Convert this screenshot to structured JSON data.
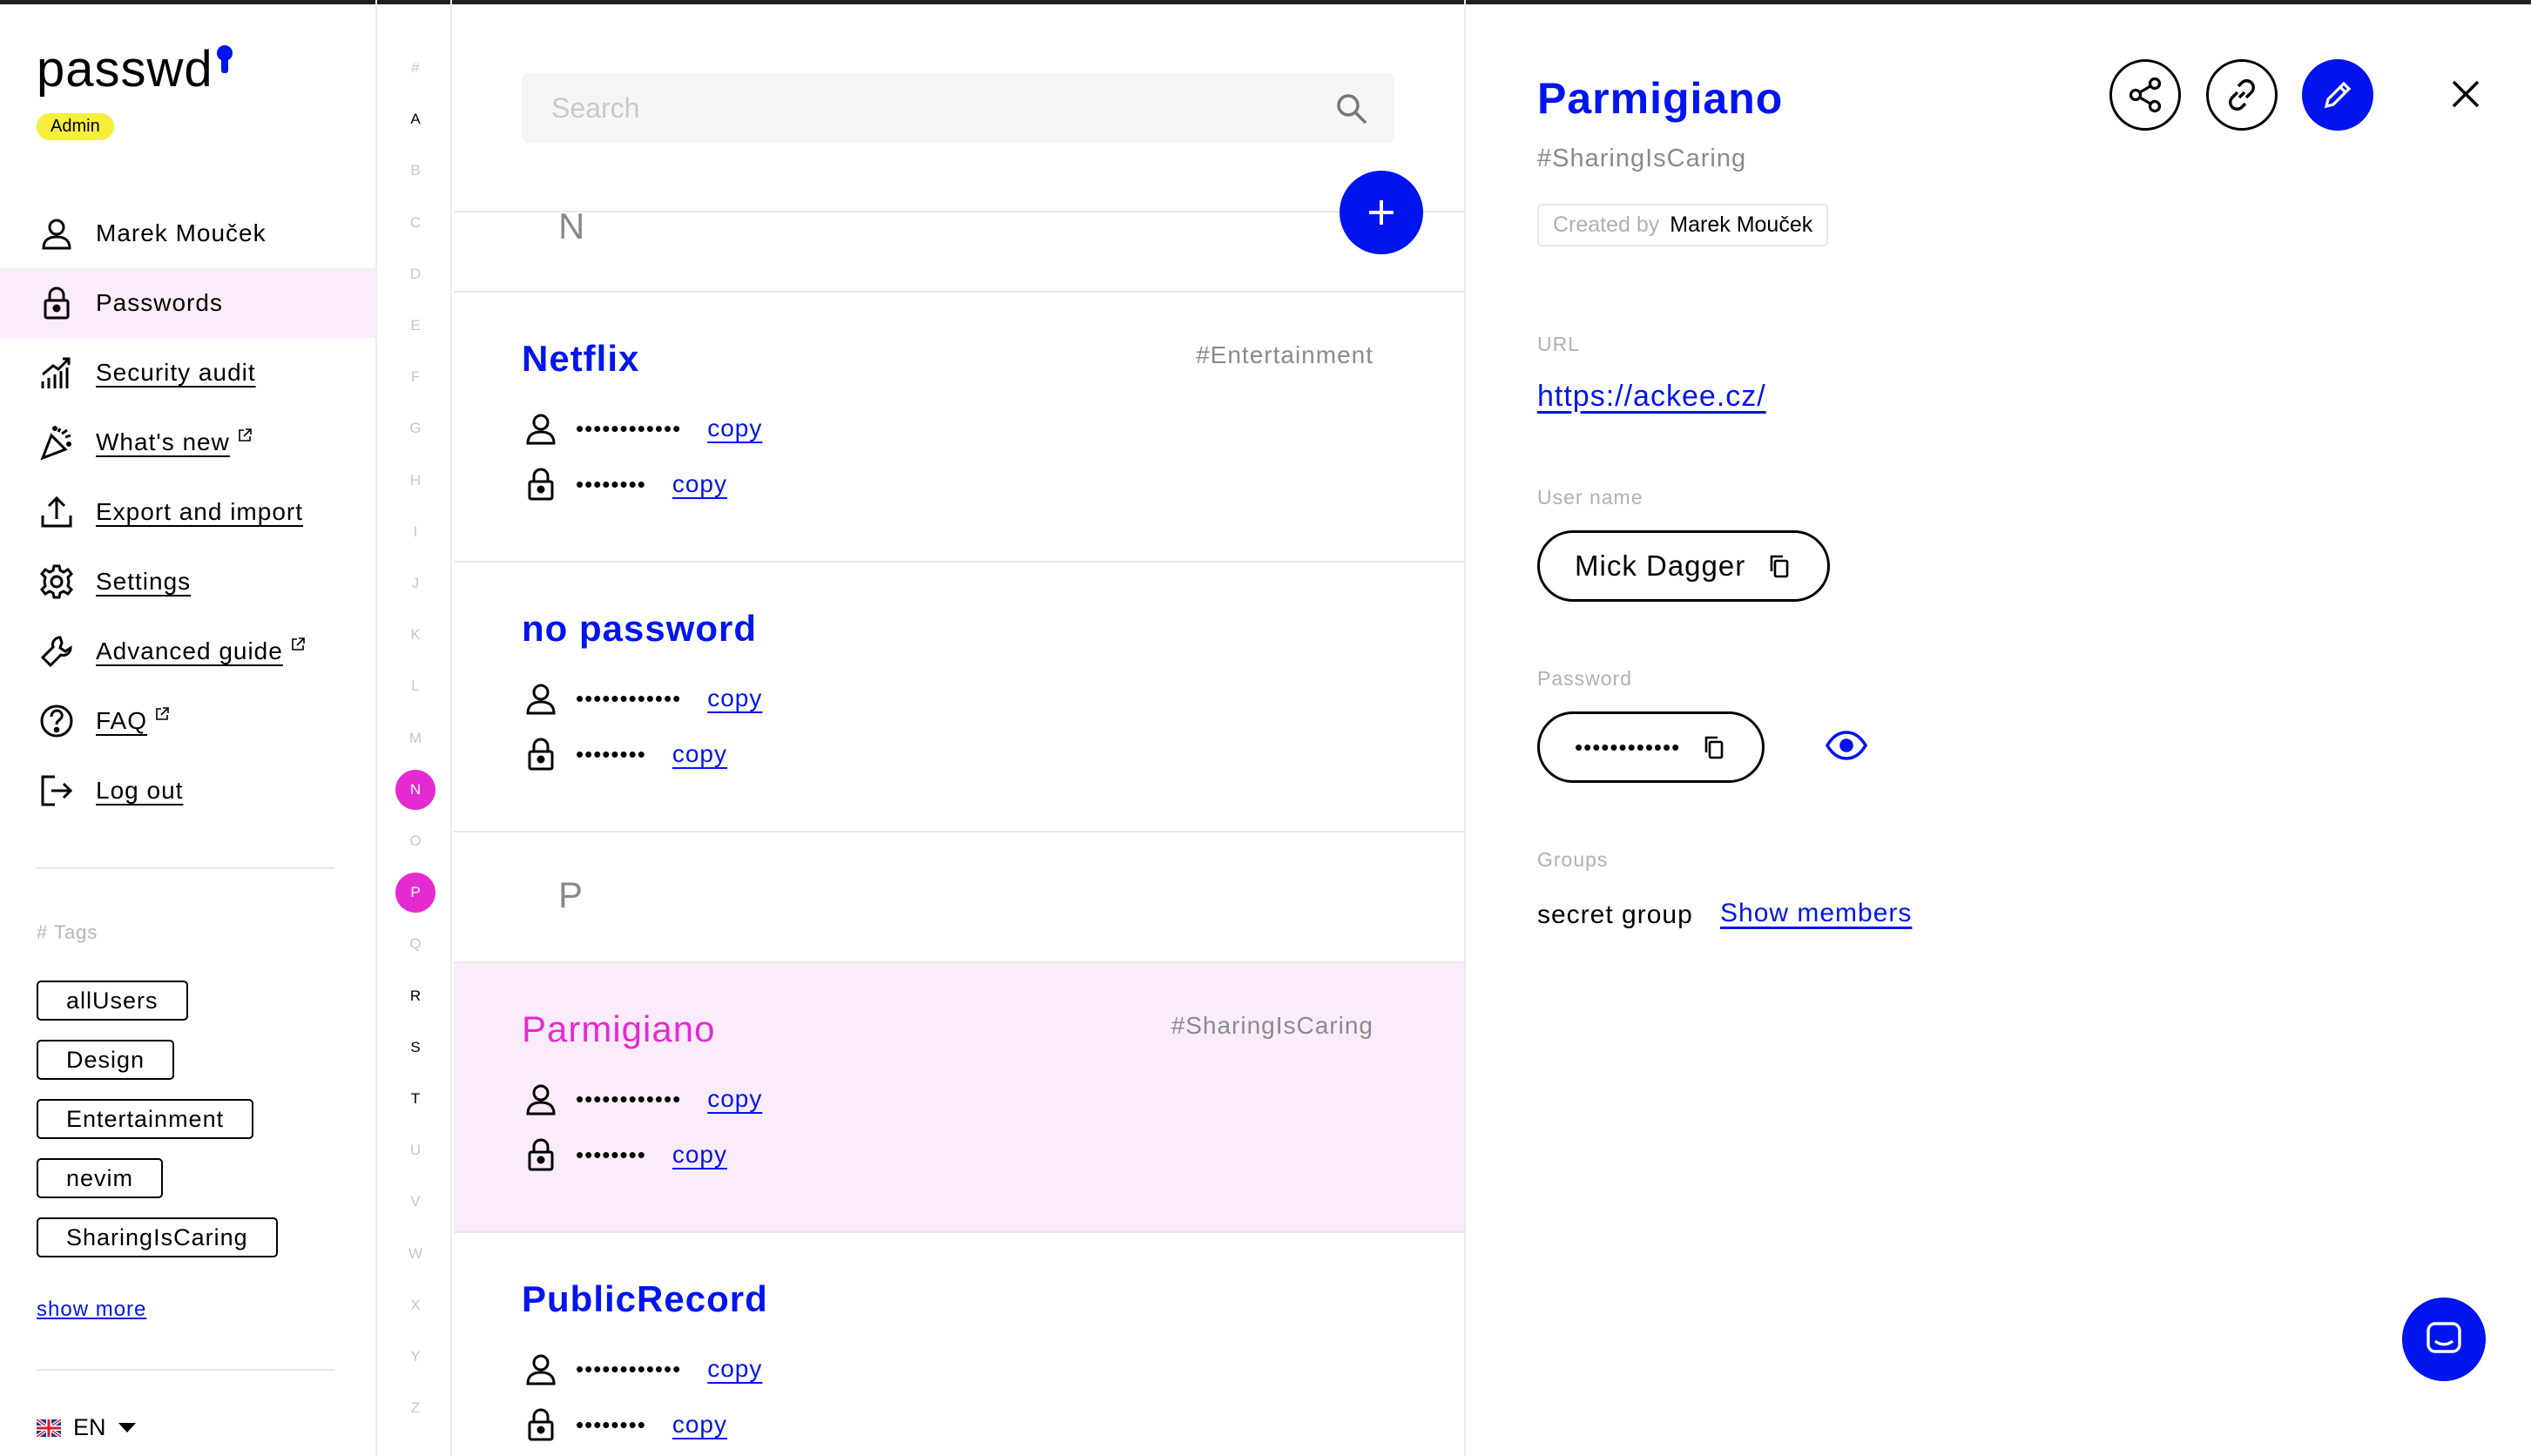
{
  "app": {
    "logo": "passwd",
    "role_badge": "Admin"
  },
  "sidebar": {
    "items": [
      {
        "label": "Marek Mouček",
        "icon": "user-icon",
        "active": false,
        "underlined": false
      },
      {
        "label": "Passwords",
        "icon": "lock-icon",
        "active": true,
        "underlined": false
      },
      {
        "label": "Security audit",
        "icon": "chart-icon",
        "active": false,
        "underlined": true
      },
      {
        "label": "What's new",
        "icon": "party-icon",
        "active": false,
        "underlined": true,
        "external": true
      },
      {
        "label": "Export and import",
        "icon": "upload-icon",
        "active": false,
        "underlined": true
      },
      {
        "label": "Settings",
        "icon": "gear-icon",
        "active": false,
        "underlined": true
      },
      {
        "label": "Advanced guide",
        "icon": "wrench-icon",
        "active": false,
        "underlined": true,
        "external": true
      },
      {
        "label": "FAQ",
        "icon": "question-icon",
        "active": false,
        "underlined": true,
        "external": true
      },
      {
        "label": "Log out",
        "icon": "logout-icon",
        "active": false,
        "underlined": true
      }
    ],
    "tags_title": "# Tags",
    "tags": [
      "allUsers",
      "Design",
      "Entertainment",
      "nevim",
      "SharingIsCaring"
    ],
    "show_more": "show more",
    "language": "EN"
  },
  "alphabet": {
    "letters": [
      "#",
      "A",
      "B",
      "C",
      "D",
      "E",
      "F",
      "G",
      "H",
      "I",
      "J",
      "K",
      "L",
      "M",
      "N",
      "O",
      "P",
      "Q",
      "R",
      "S",
      "T",
      "U",
      "V",
      "W",
      "X",
      "Y",
      "Z"
    ],
    "enabled": [
      "A",
      "R",
      "S",
      "T"
    ],
    "highlighted": [
      "N",
      "P"
    ]
  },
  "list": {
    "search_placeholder": "Search",
    "sections": [
      {
        "letter": "N"
      },
      {
        "letter": "P"
      }
    ],
    "entries": [
      {
        "title": "Netflix",
        "tag": "#Entertainment",
        "username_mask": "••••••••••••",
        "password_mask": "••••••••",
        "copy": "copy",
        "selected": false
      },
      {
        "title": "no password",
        "tag": "",
        "username_mask": "••••••••••••",
        "password_mask": "••••••••",
        "copy": "copy",
        "selected": false
      },
      {
        "title": "Parmigiano",
        "tag": "#SharingIsCaring",
        "username_mask": "••••••••••••",
        "password_mask": "••••••••",
        "copy": "copy",
        "selected": true
      },
      {
        "title": "PublicRecord",
        "tag": "",
        "username_mask": "••••••••••••",
        "password_mask": "••••••••",
        "copy": "copy",
        "selected": false
      }
    ]
  },
  "detail": {
    "title": "Parmigiano",
    "tag": "#SharingIsCaring",
    "created_by_label": "Created by",
    "created_by": "Marek Mouček",
    "url_label": "URL",
    "url": "https://ackee.cz/",
    "username_label": "User name",
    "username": "Mick Dagger",
    "password_label": "Password",
    "password_mask": "••••••••••••",
    "groups_label": "Groups",
    "group": "secret group",
    "show_members": "Show members"
  },
  "colors": {
    "accent": "#0014ee",
    "highlight": "#e62ad2",
    "selected_bg": "#fbecfb",
    "badge": "#f5ee3a"
  }
}
